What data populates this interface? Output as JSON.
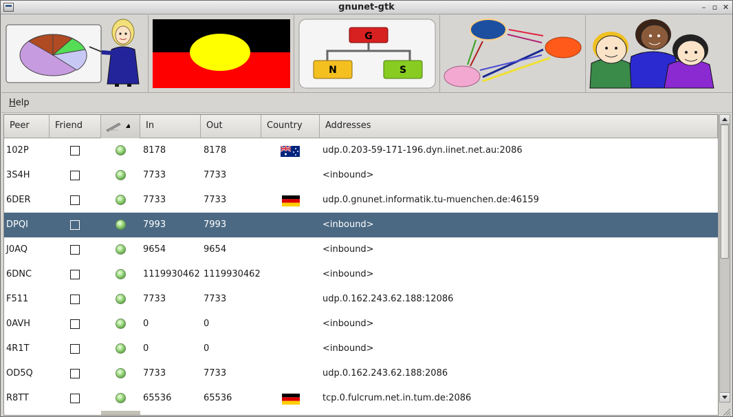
{
  "window": {
    "title": "gnunet-gtk"
  },
  "banner": {
    "tiles": [
      {
        "name": "statistics",
        "icon": "presenter-pie-chart-icon"
      },
      {
        "name": "flag",
        "icon": "aboriginal-flag-icon"
      },
      {
        "name": "gns",
        "icon": "gns-tree-icon",
        "labels": [
          "G",
          "N",
          "S"
        ]
      },
      {
        "name": "network",
        "icon": "network-graph-icon"
      },
      {
        "name": "people",
        "icon": "people-group-icon"
      }
    ]
  },
  "menubar": {
    "help_prefix": "H",
    "help_rest": "elp"
  },
  "table": {
    "headers": {
      "peer": "Peer",
      "friend": "Friend",
      "in": "In",
      "out": "Out",
      "country": "Country",
      "addresses": "Addresses"
    },
    "rows": [
      {
        "peer": "102P",
        "in": "8178",
        "out": "8178",
        "country": "AU",
        "address": "udp.0.203-59-171-196.dyn.iinet.net.au:2086"
      },
      {
        "peer": "3S4H",
        "in": "7733",
        "out": "7733",
        "country": "",
        "address": "<inbound>"
      },
      {
        "peer": "6DER",
        "in": "7733",
        "out": "7733",
        "country": "DE",
        "address": "udp.0.gnunet.informatik.tu-muenchen.de:46159"
      },
      {
        "peer": "DPQI",
        "in": "7993",
        "out": "7993",
        "country": "",
        "address": "<inbound>",
        "selected": true
      },
      {
        "peer": "J0AQ",
        "in": "9654",
        "out": "9654",
        "country": "",
        "address": "<inbound>"
      },
      {
        "peer": "6DNC",
        "in": "1119930462",
        "out": "1119930462",
        "country": "",
        "address": "<inbound>"
      },
      {
        "peer": "F511",
        "in": "7733",
        "out": "7733",
        "country": "",
        "address": "udp.0.162.243.62.188:12086"
      },
      {
        "peer": "0AVH",
        "in": "0",
        "out": "0",
        "country": "",
        "address": "<inbound>"
      },
      {
        "peer": "4R1T",
        "in": "0",
        "out": "0",
        "country": "",
        "address": "<inbound>"
      },
      {
        "peer": "OD5Q",
        "in": "7733",
        "out": "7733",
        "country": "",
        "address": "udp.0.162.243.62.188:2086"
      },
      {
        "peer": "R8TT",
        "in": "65536",
        "out": "65536",
        "country": "DE",
        "address": "tcp.0.fulcrum.net.in.tum.de:2086"
      }
    ]
  }
}
